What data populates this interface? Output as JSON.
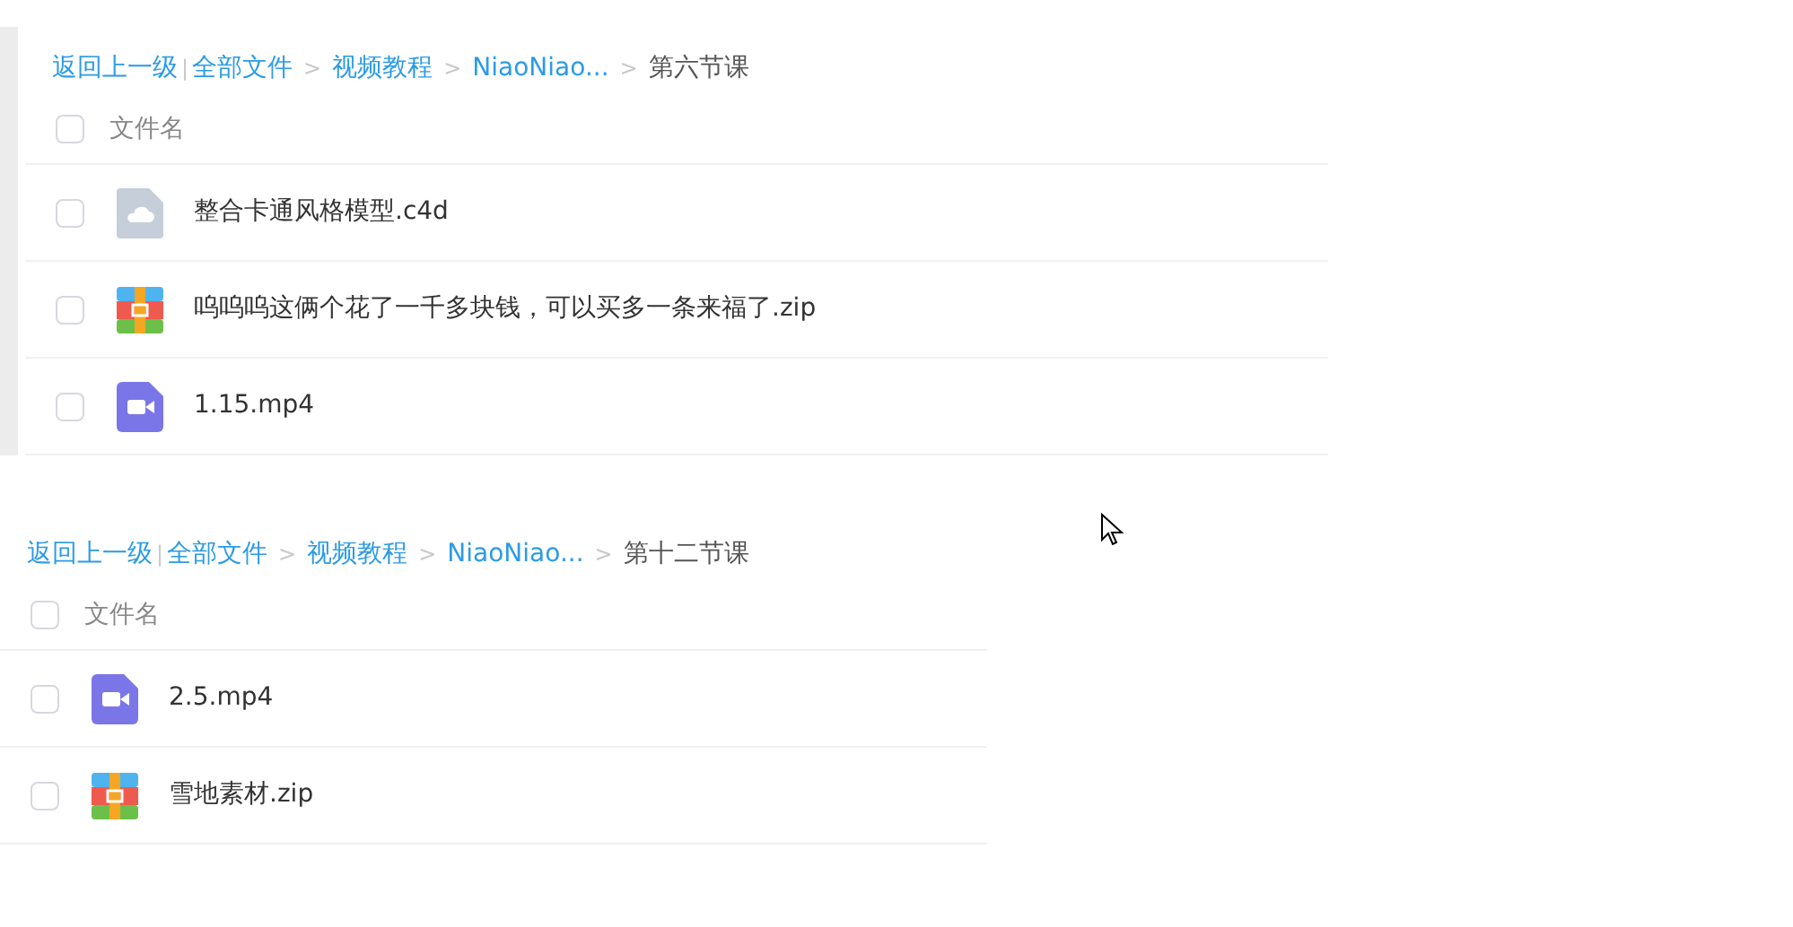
{
  "panels": [
    {
      "side_bar": true,
      "breadcrumb": [
        {
          "kind": "link",
          "text": "返回上一级"
        },
        {
          "kind": "divider",
          "text": "|"
        },
        {
          "kind": "link",
          "text": "全部文件"
        },
        {
          "kind": "separator",
          "text": ">"
        },
        {
          "kind": "link",
          "text": "视频教程"
        },
        {
          "kind": "separator",
          "text": ">"
        },
        {
          "kind": "link",
          "text": "NiaoNiao..."
        },
        {
          "kind": "separator",
          "text": ">"
        },
        {
          "kind": "current",
          "text": "第六节课"
        }
      ],
      "header": {
        "label": "文件名",
        "checked": false
      },
      "files": [
        {
          "kind": "cloud",
          "name": "整合卡通风格模型.c4d",
          "checked": false
        },
        {
          "kind": "archive",
          "name": "呜呜呜这俩个花了一千多块钱，可以买多一条来福了.zip",
          "checked": false
        },
        {
          "kind": "video",
          "name": "1.15.mp4",
          "checked": false
        }
      ]
    },
    {
      "side_bar": false,
      "breadcrumb": [
        {
          "kind": "link",
          "text": "返回上一级"
        },
        {
          "kind": "divider",
          "text": "|"
        },
        {
          "kind": "link",
          "text": "全部文件"
        },
        {
          "kind": "separator",
          "text": ">"
        },
        {
          "kind": "link",
          "text": "视频教程"
        },
        {
          "kind": "separator",
          "text": ">"
        },
        {
          "kind": "link",
          "text": "NiaoNiao..."
        },
        {
          "kind": "separator",
          "text": ">"
        },
        {
          "kind": "current",
          "text": "第十二节课"
        }
      ],
      "header": {
        "label": "文件名",
        "checked": false
      },
      "files": [
        {
          "kind": "video",
          "name": "2.5.mp4",
          "checked": false
        },
        {
          "kind": "archive",
          "name": "雪地素材.zip",
          "checked": false
        }
      ]
    }
  ]
}
